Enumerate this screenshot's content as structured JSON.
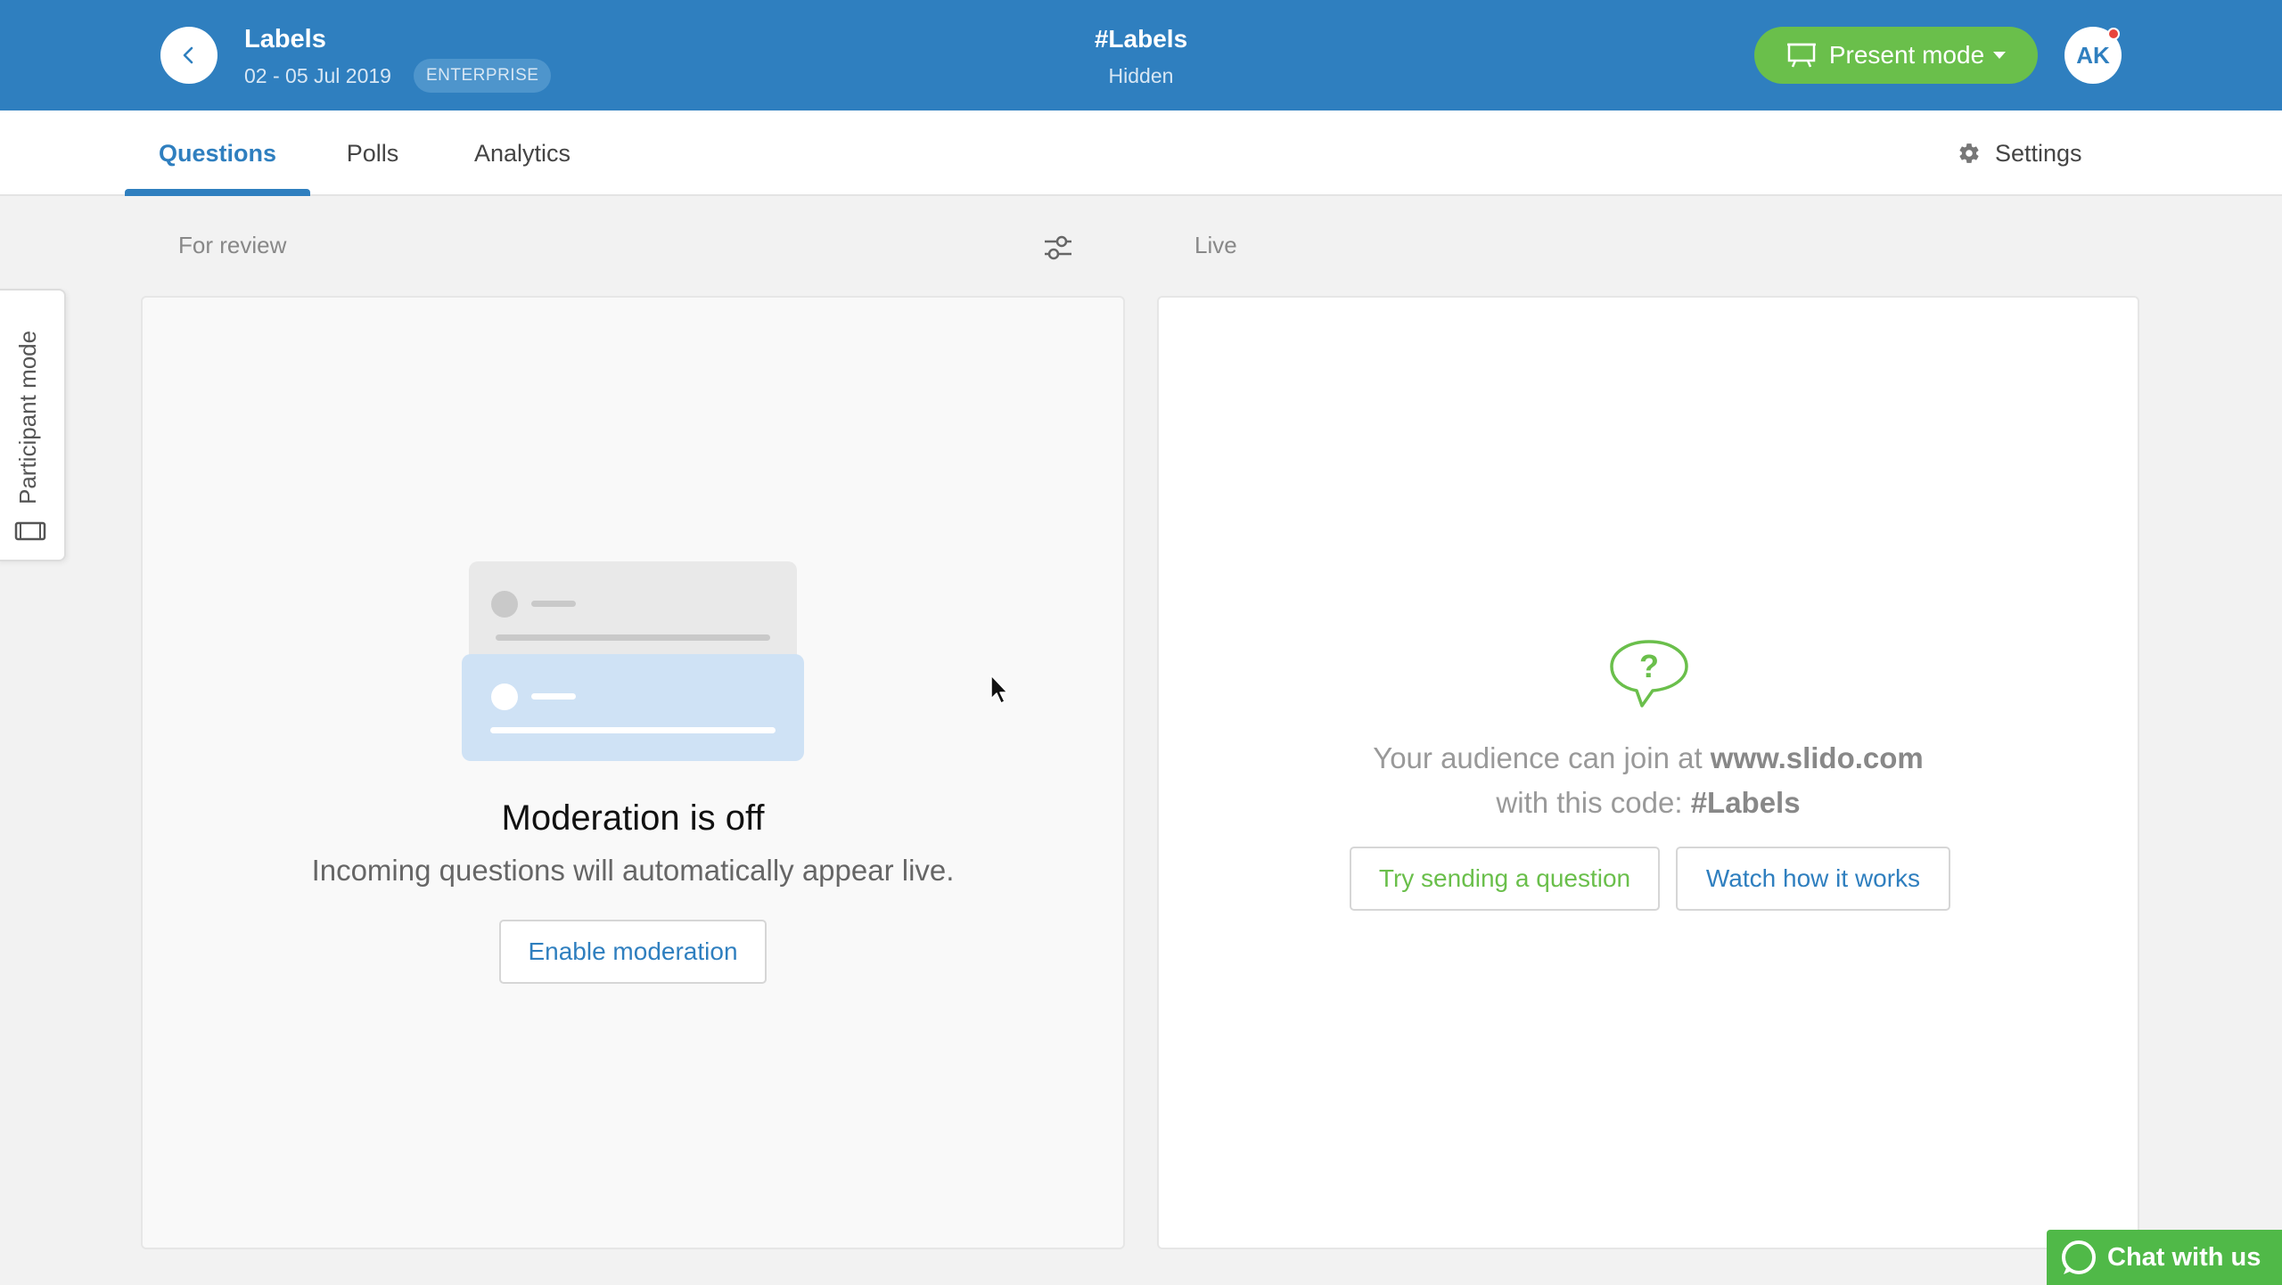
{
  "header": {
    "event_title": "Labels",
    "event_dates": "02 - 05 Jul 2019",
    "plan_badge": "ENTERPRISE",
    "event_code": "#Labels",
    "event_status": "Hidden",
    "present_mode_label": "Present mode",
    "avatar_initials": "AK"
  },
  "tabs": [
    {
      "label": "Questions",
      "active": true
    },
    {
      "label": "Polls",
      "active": false
    },
    {
      "label": "Analytics",
      "active": false
    }
  ],
  "settings_label": "Settings",
  "sections": {
    "review_label": "For review",
    "live_label": "Live"
  },
  "participant_tab_label": "Participant mode",
  "review_panel": {
    "title": "Moderation is off",
    "description": "Incoming questions will automatically appear live.",
    "enable_button": "Enable moderation"
  },
  "live_panel": {
    "join_prefix": "Your audience can join at ",
    "join_url": "www.slido.com",
    "code_prefix": "with this code: ",
    "code": "#Labels",
    "try_button": "Try sending a question",
    "watch_button": "Watch how it works"
  },
  "chat_widget_label": "Chat with us",
  "colors": {
    "brand_blue": "#2f7fbf",
    "accent_green": "#6abf4b",
    "chat_green": "#50b948",
    "notification_red": "#e8453c"
  }
}
